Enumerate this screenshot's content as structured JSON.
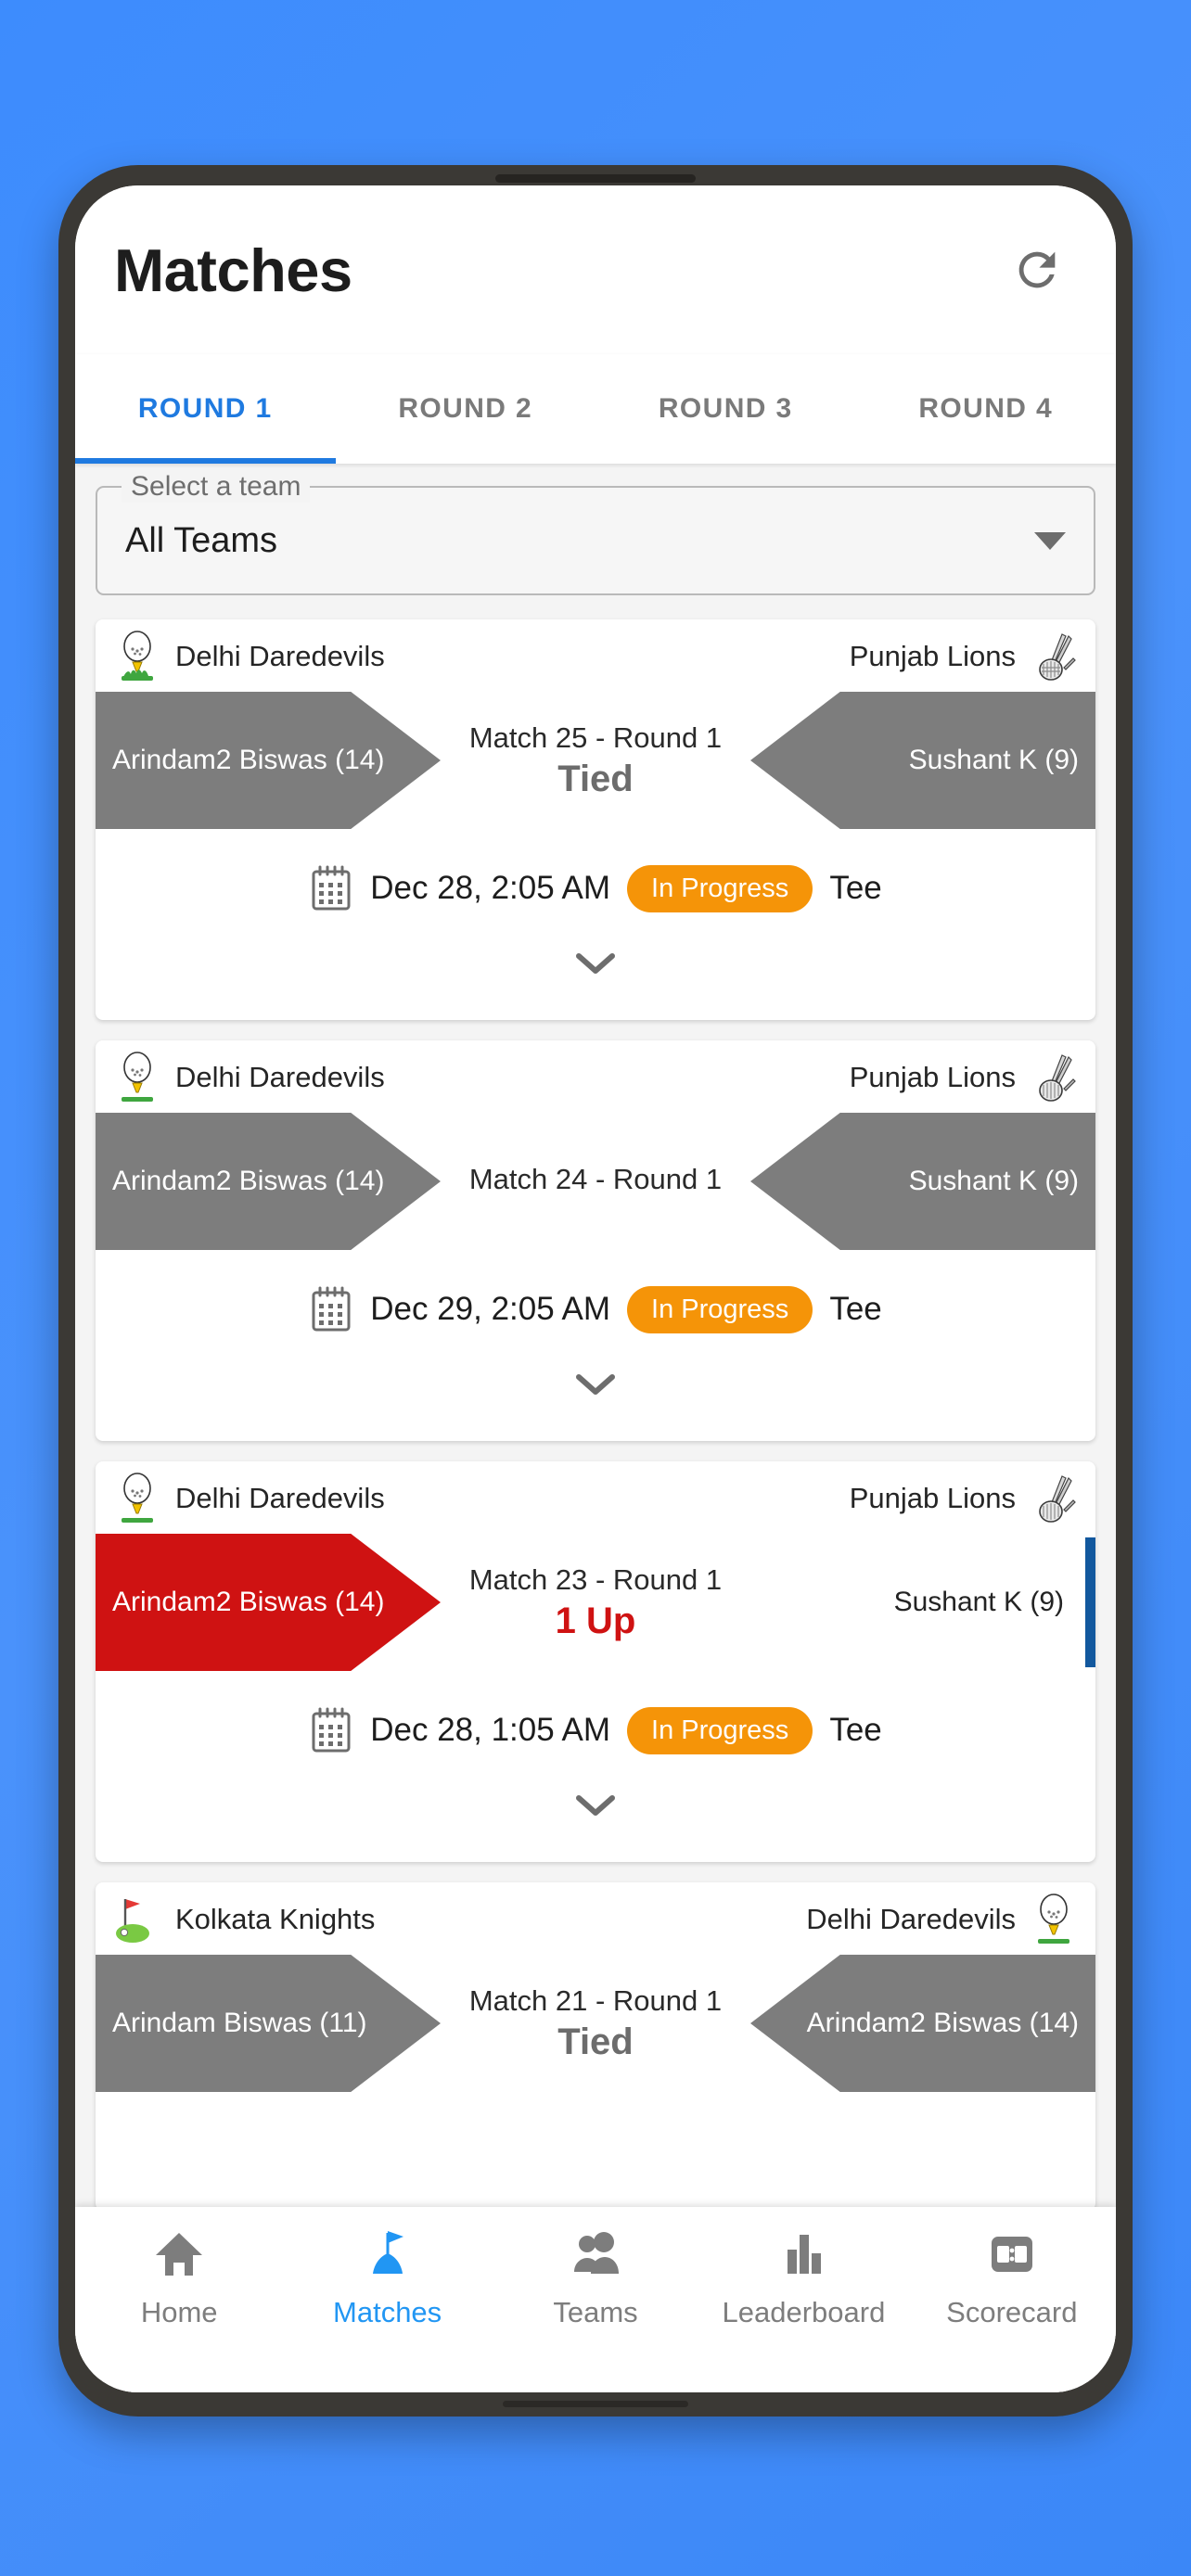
{
  "background_color": "#3d8cfd",
  "header": {
    "title": "Matches",
    "refresh_icon": "refresh-icon"
  },
  "tabs": [
    {
      "label": "ROUND 1",
      "active": true
    },
    {
      "label": "ROUND 2",
      "active": false
    },
    {
      "label": "ROUND 3",
      "active": false
    },
    {
      "label": "ROUND 4",
      "active": false
    }
  ],
  "team_filter": {
    "legend": "Select a team",
    "value": "All Teams",
    "caret_icon": "chevron-down-icon"
  },
  "colors": {
    "accent": "#2196f3",
    "tab_active": "#1f7ae0",
    "neutral_side": "#7d7d7d",
    "leading_side": "#cf1212",
    "status_pill": "#f59408",
    "blue_edge": "#12589e"
  },
  "matches": [
    {
      "left_team": "Delhi Daredevils",
      "left_team_icon": "golf-ball-tee-icon",
      "right_team": "Punjab Lions",
      "right_team_icon": "golf-clubs-icon",
      "left_player": "Arindam2 Biswas (14)",
      "right_player": "Sushant K (9)",
      "title": "Match 25 - Round 1",
      "result": "Tied",
      "result_style": "tied",
      "date": "Dec 28, 2:05 AM",
      "status": "In Progress",
      "hole": "Tee",
      "calendar_icon": "calendar-icon",
      "expand_icon": "chevron-down-icon"
    },
    {
      "left_team": "Delhi Daredevils",
      "left_team_icon": "golf-ball-tee-icon",
      "right_team": "Punjab Lions",
      "right_team_icon": "golf-clubs-icon",
      "left_player": "Arindam2 Biswas (14)",
      "right_player": "Sushant K (9)",
      "title": "Match 24 - Round 1",
      "result": "",
      "result_style": "none",
      "date": "Dec 29, 2:05 AM",
      "status": "In Progress",
      "hole": "Tee",
      "calendar_icon": "calendar-icon",
      "expand_icon": "chevron-down-icon"
    },
    {
      "left_team": "Delhi Daredevils",
      "left_team_icon": "golf-ball-tee-icon",
      "right_team": "Punjab Lions",
      "right_team_icon": "golf-clubs-icon",
      "left_player": "Arindam2 Biswas (14)",
      "right_player": "Sushant K (9)",
      "title": "Match 23 - Round 1",
      "result": "1 Up",
      "result_style": "leading",
      "date": "Dec 28, 1:05 AM",
      "status": "In Progress",
      "hole": "Tee",
      "calendar_icon": "calendar-icon",
      "expand_icon": "chevron-down-icon"
    },
    {
      "left_team": "Kolkata Knights",
      "left_team_icon": "golf-flag-green-icon",
      "right_team": "Delhi Daredevils",
      "right_team_icon": "golf-ball-tee-icon",
      "left_player": "Arindam Biswas (11)",
      "right_player": "Arindam2 Biswas (14)",
      "title": "Match 21 - Round 1",
      "result": "Tied",
      "result_style": "tied",
      "date": "",
      "status": "",
      "hole": "",
      "calendar_icon": "calendar-icon",
      "expand_icon": "chevron-down-icon"
    }
  ],
  "bottom_nav": [
    {
      "label": "Home",
      "icon": "home-icon",
      "active": false
    },
    {
      "label": "Matches",
      "icon": "golf-flag-icon",
      "active": true
    },
    {
      "label": "Teams",
      "icon": "people-icon",
      "active": false
    },
    {
      "label": "Leaderboard",
      "icon": "bar-chart-icon",
      "active": false
    },
    {
      "label": "Scorecard",
      "icon": "scoreboard-icon",
      "active": false
    }
  ]
}
